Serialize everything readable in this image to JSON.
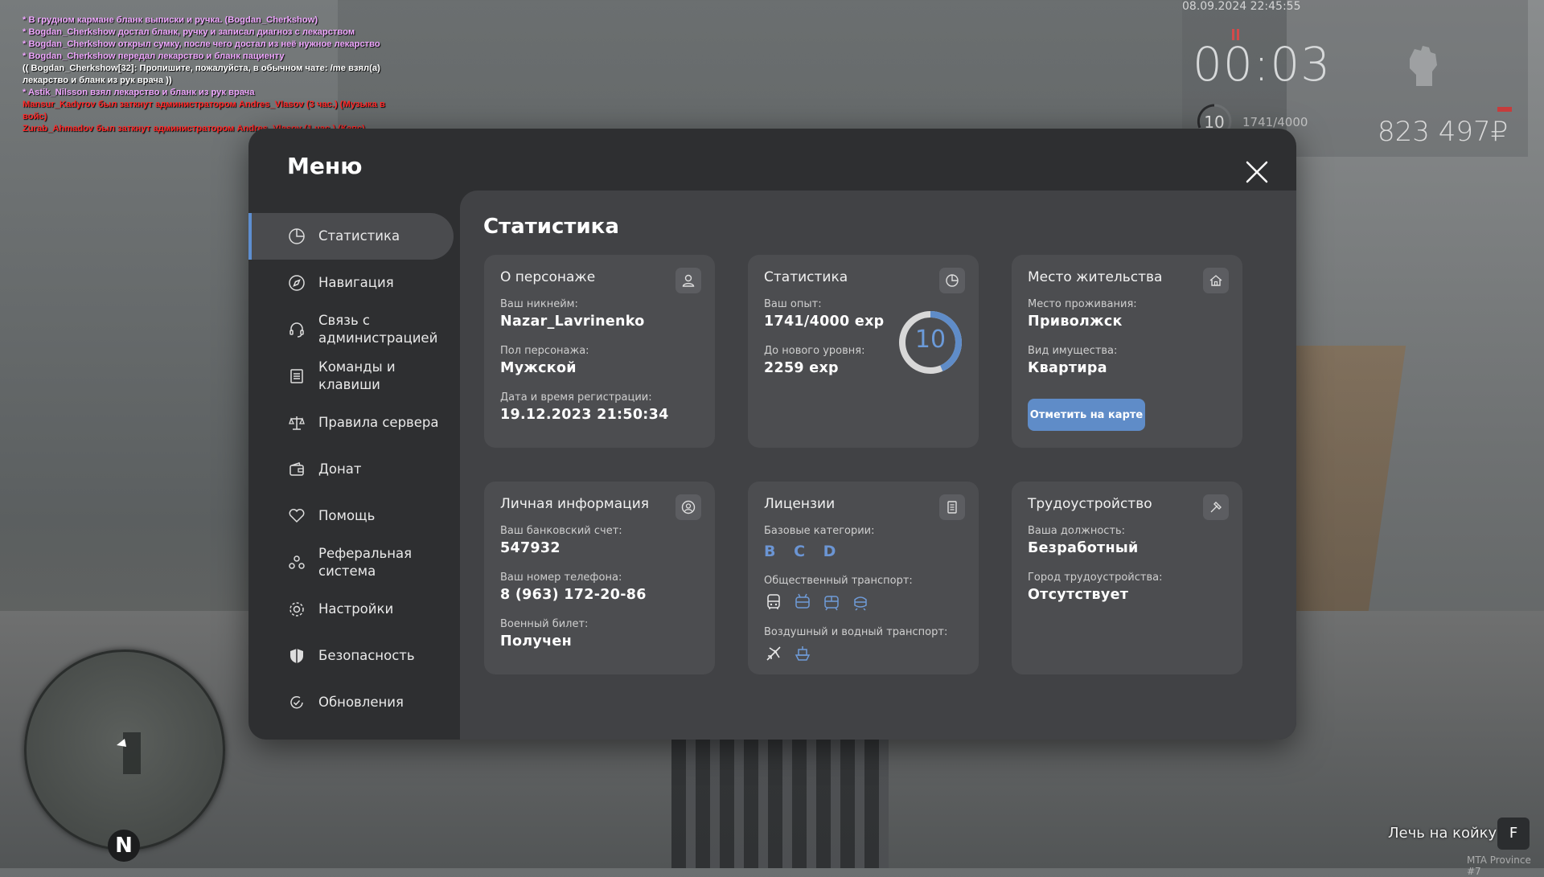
{
  "chat": [
    {
      "text": "* В грудном кармане бланк выписки и ручка. (Bogdan_Cherkshow)",
      "color": "#f0a8ff"
    },
    {
      "text": "* Bogdan_Cherkshow достал бланк, ручку и записал диагноз с лекарством",
      "color": "#f0a8ff"
    },
    {
      "text": "* Bogdan_Cherkshow открыл сумку, после чего достал из неё нужное лекарство",
      "color": "#f0a8ff"
    },
    {
      "text": "* Bogdan_Cherkshow передал лекарство и бланк пациенту",
      "color": "#f0a8ff"
    },
    {
      "text": "(( Bogdan_Cherkshow[32]: Пропишите, пожалуйста, в обычном чате: /me взял(а) лекарство и бланк из рук врача ))",
      "color": "#ffffff"
    },
    {
      "text": "* Astik_Nilsson взял лекарство и бланк из рук врача",
      "color": "#f0a8ff"
    },
    {
      "text": "Mansur_Kadyrov был заткнут администратором Andres_Vlasov (3 час.) (Музыка в войс)",
      "color": "#ff2a2a"
    },
    {
      "text": "Zurab_Ahmadov был заткнут администратором Andres_Vlasov (1 час.) (Капс)",
      "color": "#ff2a2a"
    }
  ],
  "hud": {
    "datetime": "08.09.2024 22:45:55",
    "timer": "00:03",
    "level": "10",
    "exp": "1741/4000",
    "money": "823 497₽"
  },
  "menu": {
    "title": "Меню",
    "close_icon": "close-icon",
    "sidebar": [
      {
        "label": "Статистика",
        "icon": "chart-pie-icon",
        "active": true
      },
      {
        "label": "Навигация",
        "icon": "compass-icon"
      },
      {
        "label": "Связь с\nадминистрацией",
        "icon": "headset-icon"
      },
      {
        "label": "Команды и\nклавиши",
        "icon": "list-icon"
      },
      {
        "label": "Правила сервера",
        "icon": "scales-icon"
      },
      {
        "label": "Донат",
        "icon": "wallet-icon"
      },
      {
        "label": "Помощь",
        "icon": "heart-hand-icon"
      },
      {
        "label": "Реферальная\nсистема",
        "icon": "people-icon"
      },
      {
        "label": "Настройки",
        "icon": "gear-icon"
      },
      {
        "label": "Безопасность",
        "icon": "shield-icon"
      },
      {
        "label": "Обновления",
        "icon": "refresh-check-icon"
      }
    ]
  },
  "stats": {
    "title": "Статистика",
    "character": {
      "title": "О персонаже",
      "nick_label": "Ваш никнейм:",
      "nick": "Nazar_Lavrinenko",
      "gender_label": "Пол персонажа:",
      "gender": "Мужской",
      "reg_label": "Дата и время регистрации:",
      "reg": "19.12.2023 21:50:34"
    },
    "statistics": {
      "title": "Статистика",
      "exp_label": "Ваш опыт:",
      "exp": "1741/4000 exp",
      "next_label": "До нового уровня:",
      "next": "2259 exp",
      "level": "10",
      "progress": 0.435
    },
    "residence": {
      "title": "Место жительства",
      "place_label": "Место проживания:",
      "place": "Приволжск",
      "type_label": "Вид имущества:",
      "type": "Квартира",
      "button": "Отметить на карте"
    },
    "personal": {
      "title": "Личная информация",
      "bank_label": "Ваш банковский счет:",
      "bank": "547932",
      "phone_label": "Ваш номер телефона:",
      "phone": "8 (963) 172-20-86",
      "military_label": "Военный билет:",
      "military": "Получен"
    },
    "licenses": {
      "title": "Лицензии",
      "base_label": "Базовые категории:",
      "base": "B C D",
      "public_label": "Общественный транспорт:",
      "air_label": "Воздушный и водный транспорт:"
    },
    "employment": {
      "title": "Трудоустройство",
      "job_label": "Ваша должность:",
      "job": "Безработный",
      "city_label": "Город трудоустройства:",
      "city": "Отсутствует"
    }
  },
  "hint": {
    "text": "Лечь на койку",
    "key": "F"
  },
  "watermark": "MTA Province #7",
  "colors": {
    "accent": "#5d8ed0",
    "chat_action": "#f0a8ff",
    "chat_warning": "#ff2a2a"
  }
}
